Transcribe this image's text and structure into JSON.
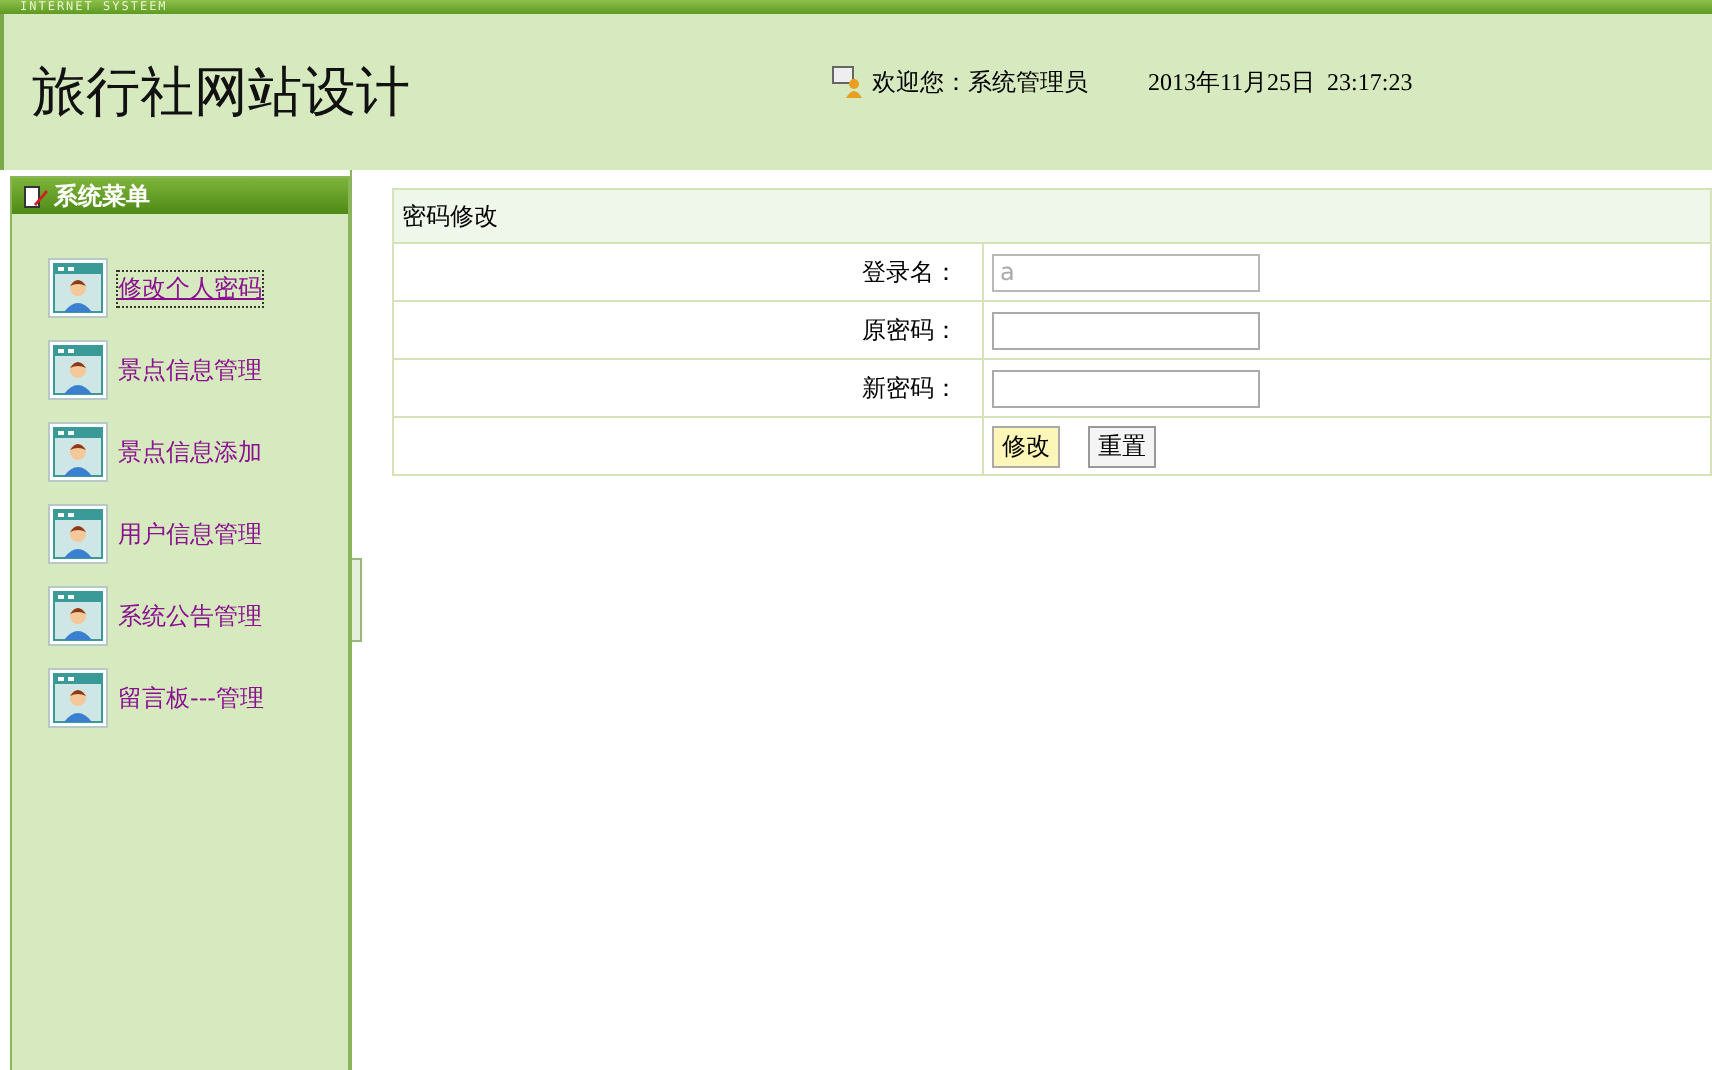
{
  "top_bar": {
    "text": "INTERNET SYSTEEM"
  },
  "header": {
    "title": "旅行社网站设计",
    "welcome": "欢迎您：系统管理员",
    "datetime": "2013年11月25日  23:17:23"
  },
  "sidebar": {
    "title": "系统菜单",
    "items": [
      {
        "label": "修改个人密码",
        "focused": true
      },
      {
        "label": "景点信息管理",
        "focused": false
      },
      {
        "label": "景点信息添加",
        "focused": false
      },
      {
        "label": "用户信息管理",
        "focused": false
      },
      {
        "label": "系统公告管理",
        "focused": false
      },
      {
        "label": "留言板---管理",
        "focused": false
      }
    ]
  },
  "form": {
    "title": "密码修改",
    "fields": [
      {
        "label": "登录名：",
        "value": "a",
        "disabled": true
      },
      {
        "label": "原密码：",
        "disabled": false
      },
      {
        "label": "新密码：",
        "disabled": false
      }
    ],
    "buttons": [
      {
        "label": "修改",
        "highlighted": true
      },
      {
        "label": "重置",
        "highlighted": false
      }
    ]
  }
}
